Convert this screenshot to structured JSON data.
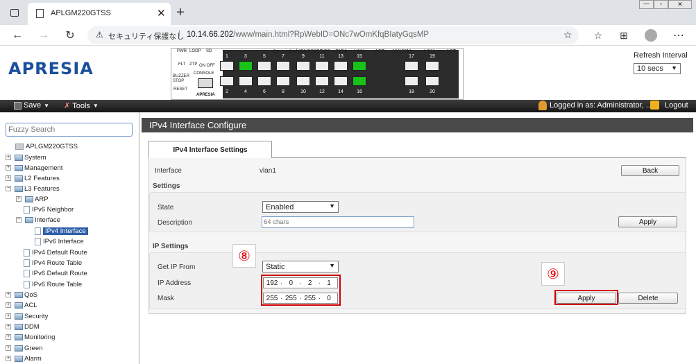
{
  "browser": {
    "tab_title": "APLGM220GTSS",
    "security_label": "セキュリティ保護なし",
    "url_host": "10.14.66.202",
    "url_path": "/www/main.html?RpWebID=ONc7wOmKfqBIatyGqsMP"
  },
  "header": {
    "logo": "APRESIA",
    "panel": {
      "model": "ApresiaLightGM220GT-SS",
      "giga_label": "GIGA",
      "link_label": "LINK",
      "act_label": "ACT",
      "speed_label": "10/100M",
      "led_labels": [
        "PWR",
        "LOOP",
        "SD",
        "FLT",
        "ZTP",
        "ON OFF"
      ],
      "buzzer_label": "BUZZER STOP",
      "reset_label": "RESET",
      "console_label": "CONSOLE",
      "brand": "APRESIA",
      "top_ports": [
        "1",
        "3",
        "5",
        "7",
        "9",
        "11",
        "13",
        "15",
        "17",
        "19"
      ],
      "bottom_ports": [
        "2",
        "4",
        "6",
        "8",
        "10",
        "12",
        "14",
        "16",
        "18",
        "20"
      ]
    },
    "refresh_label": "Refresh Interval",
    "refresh_value": "10 secs"
  },
  "menubar": {
    "save": "Save",
    "tools": "Tools",
    "logged_in": "Logged in as: Administrator, ..",
    "logout": "Logout"
  },
  "sidebar": {
    "search_placeholder": "Fuzzy Search",
    "root": "APLGM220GTSS",
    "items": [
      {
        "label": "System"
      },
      {
        "label": "Management"
      },
      {
        "label": "L2 Features"
      },
      {
        "label": "L3 Features"
      },
      {
        "label": "ARP"
      },
      {
        "label": "IPv6 Neighbor"
      },
      {
        "label": "Interface"
      },
      {
        "label": "IPv4 Interface"
      },
      {
        "label": "IPv6 Interface"
      },
      {
        "label": "IPv4 Default Route"
      },
      {
        "label": "IPv4 Route Table"
      },
      {
        "label": "IPv6 Default Route"
      },
      {
        "label": "IPv6 Route Table"
      },
      {
        "label": "QoS"
      },
      {
        "label": "ACL"
      },
      {
        "label": "Security"
      },
      {
        "label": "DDM"
      },
      {
        "label": "Monitoring"
      },
      {
        "label": "Green"
      },
      {
        "label": "Alarm"
      }
    ]
  },
  "main": {
    "title": "IPv4 Interface Configure",
    "tab": "IPv4 Interface Settings",
    "interface_label": "Interface",
    "interface_value": "vlan1",
    "back_button": "Back",
    "settings": {
      "title": "Settings",
      "state_label": "State",
      "state_value": "Enabled",
      "description_label": "Description",
      "description_placeholder": "64 chars",
      "apply_button": "Apply"
    },
    "ip_settings": {
      "title": "IP Settings",
      "get_ip_label": "Get IP From",
      "get_ip_value": "Static",
      "ip_label": "IP Address",
      "ip_octets": [
        "192",
        "0",
        "2",
        "1"
      ],
      "mask_label": "Mask",
      "mask_octets": [
        "255",
        "255",
        "255",
        "0"
      ],
      "apply_button": "Apply",
      "delete_button": "Delete"
    },
    "callouts": [
      "⑧",
      "⑨"
    ]
  },
  "colors": {
    "accent_blue": "#1b4f9c",
    "title_bar": "#4a4a4a",
    "highlight_red": "#d00000",
    "port_green": "#19c219"
  }
}
